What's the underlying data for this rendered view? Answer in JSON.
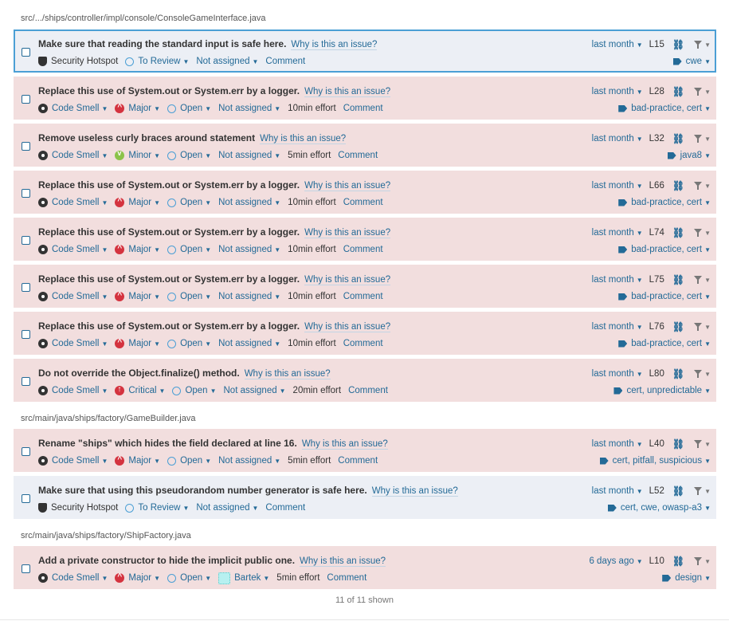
{
  "files": [
    {
      "path": "src/.../ships/controller/impl/console/ConsoleGameInterface.java",
      "issues": [
        {
          "kind": "hotspot",
          "selected": true,
          "message": "Make sure that reading the standard input is safe here.",
          "why": "Why is this an issue?",
          "type": "Security Hotspot",
          "status": "To Review",
          "assignee": "Not assigned",
          "comment": "Comment",
          "date": "last month",
          "line": "L15",
          "tags": "cwe"
        },
        {
          "kind": "smell",
          "message": "Replace this use of System.out or System.err by a logger.",
          "why": "Why is this an issue?",
          "type": "Code Smell",
          "severity": "Major",
          "status": "Open",
          "assignee": "Not assigned",
          "effort": "10min effort",
          "comment": "Comment",
          "date": "last month",
          "line": "L28",
          "tags": "bad-practice, cert"
        },
        {
          "kind": "smell",
          "message": "Remove useless curly braces around statement",
          "why": "Why is this an issue?",
          "type": "Code Smell",
          "severity": "Minor",
          "status": "Open",
          "assignee": "Not assigned",
          "effort": "5min effort",
          "comment": "Comment",
          "date": "last month",
          "line": "L32",
          "tags": "java8"
        },
        {
          "kind": "smell",
          "message": "Replace this use of System.out or System.err by a logger.",
          "why": "Why is this an issue?",
          "type": "Code Smell",
          "severity": "Major",
          "status": "Open",
          "assignee": "Not assigned",
          "effort": "10min effort",
          "comment": "Comment",
          "date": "last month",
          "line": "L66",
          "tags": "bad-practice, cert"
        },
        {
          "kind": "smell",
          "message": "Replace this use of System.out or System.err by a logger.",
          "why": "Why is this an issue?",
          "type": "Code Smell",
          "severity": "Major",
          "status": "Open",
          "assignee": "Not assigned",
          "effort": "10min effort",
          "comment": "Comment",
          "date": "last month",
          "line": "L74",
          "tags": "bad-practice, cert"
        },
        {
          "kind": "smell",
          "message": "Replace this use of System.out or System.err by a logger.",
          "why": "Why is this an issue?",
          "type": "Code Smell",
          "severity": "Major",
          "status": "Open",
          "assignee": "Not assigned",
          "effort": "10min effort",
          "comment": "Comment",
          "date": "last month",
          "line": "L75",
          "tags": "bad-practice, cert"
        },
        {
          "kind": "smell",
          "message": "Replace this use of System.out or System.err by a logger.",
          "why": "Why is this an issue?",
          "type": "Code Smell",
          "severity": "Major",
          "status": "Open",
          "assignee": "Not assigned",
          "effort": "10min effort",
          "comment": "Comment",
          "date": "last month",
          "line": "L76",
          "tags": "bad-practice, cert"
        },
        {
          "kind": "smell",
          "message": "Do not override the Object.finalize() method.",
          "why": "Why is this an issue?",
          "type": "Code Smell",
          "severity": "Critical",
          "status": "Open",
          "assignee": "Not assigned",
          "effort": "20min effort",
          "comment": "Comment",
          "date": "last month",
          "line": "L80",
          "tags": "cert, unpredictable"
        }
      ]
    },
    {
      "path": "src/main/java/ships/factory/GameBuilder.java",
      "issues": [
        {
          "kind": "smell",
          "message": "Rename \"ships\" which hides the field declared at line 16.",
          "why": "Why is this an issue?",
          "type": "Code Smell",
          "severity": "Major",
          "status": "Open",
          "assignee": "Not assigned",
          "effort": "5min effort",
          "comment": "Comment",
          "date": "last month",
          "line": "L40",
          "tags": "cert, pitfall, suspicious"
        },
        {
          "kind": "hotspot",
          "message": "Make sure that using this pseudorandom number generator is safe here.",
          "why": "Why is this an issue?",
          "type": "Security Hotspot",
          "status": "To Review",
          "assignee": "Not assigned",
          "comment": "Comment",
          "date": "last month",
          "line": "L52",
          "tags": "cert, cwe, owasp-a3"
        }
      ]
    },
    {
      "path": "src/main/java/ships/factory/ShipFactory.java",
      "issues": [
        {
          "kind": "smell",
          "message": "Add a private constructor to hide the implicit public one.",
          "why": "Why is this an issue?",
          "type": "Code Smell",
          "severity": "Major",
          "status": "Open",
          "assignee": "Bartek",
          "avatar": true,
          "effort": "5min effort",
          "comment": "Comment",
          "date": "6 days ago",
          "line": "L10",
          "tags": "design"
        }
      ]
    }
  ],
  "footer": "11 of 11 shown",
  "colors": {
    "link": "#236a97",
    "issue_bg": "#f2dede",
    "hotspot_bg": "#eceff5",
    "selected_border": "#4b9fd5",
    "major": "#d4333f",
    "minor": "#8bc34a"
  },
  "icons": {
    "type_smell": "code-smell-icon",
    "type_hotspot": "shield-icon",
    "link": "link-icon",
    "filter": "filter-icon",
    "tag": "tag-icon",
    "status": "open-circle-icon"
  }
}
